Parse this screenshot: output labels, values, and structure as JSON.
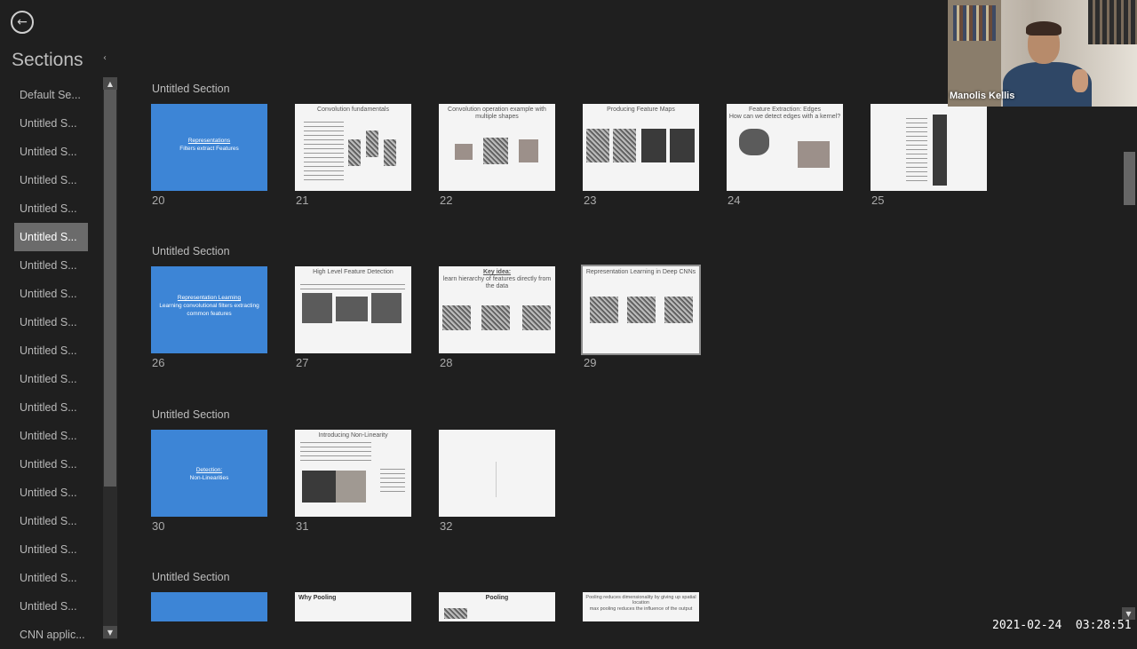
{
  "sidebar": {
    "title": "Sections",
    "collapse_icon": "chevron-left-icon",
    "items": [
      {
        "label": "Default Se...",
        "active": false
      },
      {
        "label": "Untitled S...",
        "active": false
      },
      {
        "label": "Untitled S...",
        "active": false
      },
      {
        "label": "Untitled S...",
        "active": false
      },
      {
        "label": "Untitled S...",
        "active": false
      },
      {
        "label": "Untitled S...",
        "active": true
      },
      {
        "label": "Untitled S...",
        "active": false
      },
      {
        "label": "Untitled S...",
        "active": false
      },
      {
        "label": "Untitled S...",
        "active": false
      },
      {
        "label": "Untitled S...",
        "active": false
      },
      {
        "label": "Untitled S...",
        "active": false
      },
      {
        "label": "Untitled S...",
        "active": false
      },
      {
        "label": "Untitled S...",
        "active": false
      },
      {
        "label": "Untitled S...",
        "active": false
      },
      {
        "label": "Untitled S...",
        "active": false
      },
      {
        "label": "Untitled S...",
        "active": false
      },
      {
        "label": "Untitled S...",
        "active": false
      },
      {
        "label": "Untitled S...",
        "active": false
      },
      {
        "label": "Untitled S...",
        "active": false
      },
      {
        "label": "CNN applic...",
        "active": false
      }
    ]
  },
  "sections": [
    {
      "title": "Untitled Section",
      "slides": [
        {
          "num": "20",
          "kind": "blue",
          "title_underlined": "Representations",
          "title_rest": "Filters extract Features"
        },
        {
          "num": "21",
          "kind": "white",
          "title": "Convolution fundamentals"
        },
        {
          "num": "22",
          "kind": "white",
          "title": "Convolution operation example with multiple shapes"
        },
        {
          "num": "23",
          "kind": "white",
          "title": "Producing Feature Maps"
        },
        {
          "num": "24",
          "kind": "white",
          "title": "Feature Extraction: Edges",
          "subtitle": "How can we detect edges with a kernel?"
        },
        {
          "num": "25",
          "kind": "white",
          "title": ""
        }
      ]
    },
    {
      "title": "Untitled Section",
      "slides": [
        {
          "num": "26",
          "kind": "blue",
          "title_underlined": "Representation Learning",
          "title_rest": "Learning convolutional filters extracting common features"
        },
        {
          "num": "27",
          "kind": "white",
          "title": "High Level Feature Detection"
        },
        {
          "num": "28",
          "kind": "white",
          "title": "Key idea:",
          "subtitle": "learn hierarchy of features directly from the data"
        },
        {
          "num": "29",
          "kind": "white",
          "title": "Representation Learning in Deep CNNs",
          "selected": true
        }
      ]
    },
    {
      "title": "Untitled Section",
      "slides": [
        {
          "num": "30",
          "kind": "blue",
          "title_underlined": "Detection:",
          "title_rest": "Non-Linearities"
        },
        {
          "num": "31",
          "kind": "white",
          "title": "Introducing Non-Linearity"
        },
        {
          "num": "32",
          "kind": "white",
          "title": ""
        }
      ]
    },
    {
      "title": "Untitled Section",
      "slides": [
        {
          "num": "",
          "kind": "blue",
          "title_underlined": "",
          "title_rest": ""
        },
        {
          "num": "",
          "kind": "white",
          "title": "Why Pooling"
        },
        {
          "num": "",
          "kind": "white",
          "title": "Pooling"
        },
        {
          "num": "",
          "kind": "white",
          "title": "Pooling reduces dimensionality by giving up spatial location",
          "subtitle": "max pooling reduces the influence of the output"
        }
      ]
    }
  ],
  "video": {
    "participant_name": "Manolis Kellis"
  },
  "timestamp": "2021-02-24  03:28:51",
  "colors": {
    "background": "#1f1f1f",
    "accent_slide": "#3d85d6",
    "selected_sidebar": "#6b6b6b"
  }
}
